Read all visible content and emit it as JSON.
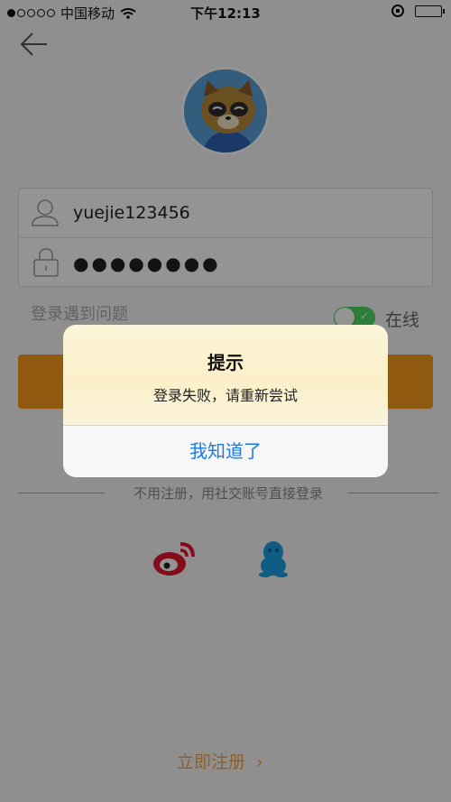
{
  "status_bar": {
    "carrier": "中国移动",
    "time": "下午12:13"
  },
  "login_form": {
    "username": "yuejie123456",
    "password_masked": "●●●●●●●●"
  },
  "help_link": "登录遇到问题",
  "online_toggle": {
    "label": "在线",
    "on": true
  },
  "divider_text": "不用注册，用社交账号直接登录",
  "register_link": "立即注册",
  "alert": {
    "title": "提示",
    "message": "登录失败，请重新尝试",
    "button": "我知道了"
  },
  "colors": {
    "accent": "#f89a1c",
    "toggle_on": "#4cd964",
    "dialog_button": "#1b7ce0"
  }
}
